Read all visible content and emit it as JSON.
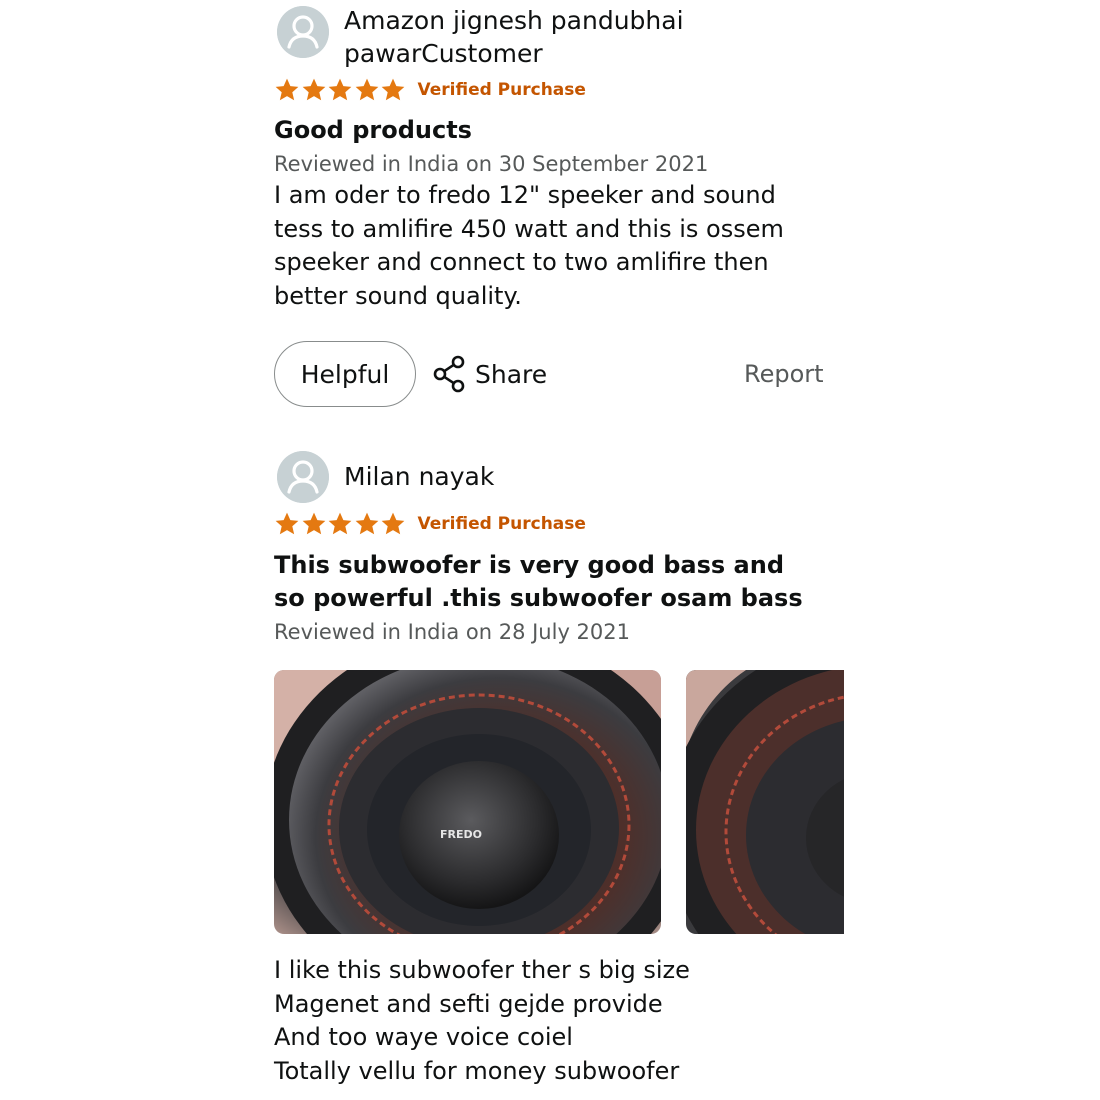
{
  "colors": {
    "star": "#e47911",
    "verified": "#c45500",
    "secondary_text": "#565959"
  },
  "reviews": [
    {
      "reviewer": "Amazon jignesh pandubhai pawarCustomer",
      "rating": 5,
      "verified": "Verified Purchase",
      "title": "Good products",
      "date": "Reviewed in India on 30 September 2021",
      "body": "I am oder to fredo 12\" speeker and sound tess to amlifire 450 watt and this is ossem speeker and connect to two amlifire then better sound quality.",
      "actions": {
        "helpful": "Helpful",
        "share": "Share",
        "report": "Report"
      }
    },
    {
      "reviewer": "Milan nayak",
      "rating": 5,
      "verified": "Verified Purchase",
      "title": "This subwoofer is very good bass and so powerful .this subwoofer osam bass",
      "date": "Reviewed in India on 28 July 2021",
      "image_brand": "FREDO",
      "body": "I like this subwoofer ther s big size\nMagenet and sefti gejde provide\nAnd too waye voice coiel\nTotally vellu for money subwoofer"
    }
  ]
}
